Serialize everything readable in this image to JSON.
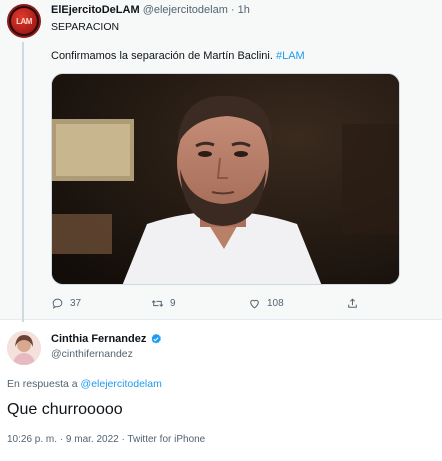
{
  "tweet": {
    "author_name": "ElEjercitoDeLAM",
    "author_handle": "@elejercitodelam",
    "separator": "·",
    "time": "1h",
    "avatar_text": "LAM",
    "title_line": "SEPARACION",
    "text_prefix": "Confirmamos la separación de Martín Baclini. ",
    "hashtag": "#LAM",
    "replies": "37",
    "retweets": "9",
    "likes": "108"
  },
  "reply": {
    "author_name": "Cinthia Fernandez",
    "author_handle": "@cinthifernandez",
    "reply_label": "En respuesta a ",
    "reply_mention": "@elejercitodelam",
    "text": "Que churrooooo",
    "meta": "10:26 p. m. · 9 mar. 2022 · Twitter for iPhone"
  },
  "colors": {
    "link": "#1d9bf0",
    "muted": "#536471",
    "verified": "#1d9bf0"
  }
}
